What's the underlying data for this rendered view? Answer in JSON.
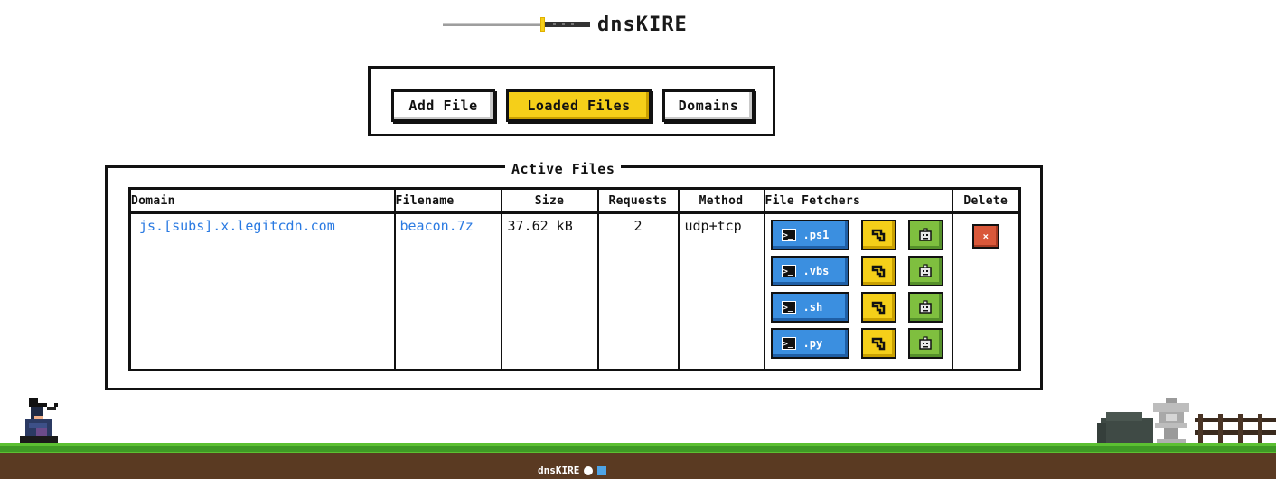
{
  "app": {
    "title": "dnsKIRE",
    "logo_icon": "katana-icon"
  },
  "menu": {
    "buttons": [
      {
        "label": "Add File",
        "active": false
      },
      {
        "label": "Loaded Files",
        "active": true
      },
      {
        "label": "Domains",
        "active": false
      }
    ]
  },
  "panel": {
    "title": "Active Files",
    "columns": [
      "Domain",
      "Filename",
      "Size",
      "Requests",
      "Method",
      "File Fetchers",
      "Delete"
    ],
    "rows": [
      {
        "domain": "js.[subs].x.legitcdn.com",
        "filename": "beacon.7z",
        "size": "37.62 kB",
        "requests": "2",
        "method": "udp+tcp",
        "fetchers": [
          {
            "label": ".ps1",
            "icon": "terminal-icon"
          },
          {
            "label": ".vbs",
            "icon": "terminal-icon"
          },
          {
            "label": ".sh",
            "icon": "terminal-icon"
          },
          {
            "label": ".py",
            "icon": "terminal-icon"
          }
        ],
        "delete_label": "×"
      }
    ]
  },
  "footer": {
    "text": "dnsKIRE",
    "icons": [
      "github-icon",
      "twitter-icon"
    ]
  },
  "colors": {
    "accent_yellow": "#f5cf19",
    "fetch_blue": "#3b8fe0",
    "fetch_green": "#7fbf3f",
    "delete_red": "#d9583a",
    "link_blue": "#2a7ae2",
    "grass": "#5cc032",
    "dirt": "#5a3a22"
  }
}
